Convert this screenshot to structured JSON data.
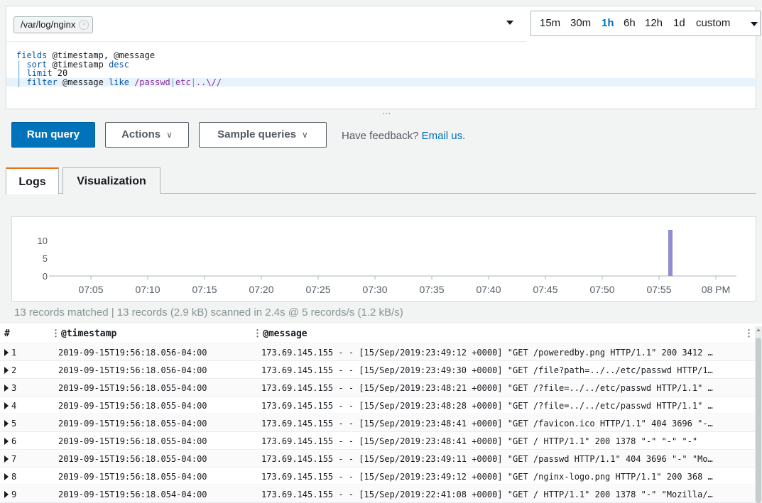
{
  "log_group": {
    "token": "/var/log/nginx",
    "remove_glyph": "×"
  },
  "time_range": {
    "options": [
      "15m",
      "30m",
      "1h",
      "6h",
      "12h",
      "1d",
      "custom"
    ],
    "active": "1h"
  },
  "query": {
    "line1": {
      "kw": "fields",
      "rest": " @timestamp, @message"
    },
    "line2": {
      "pipe": "| ",
      "kw": "sort",
      "rest": " @timestamp ",
      "kw2": "desc"
    },
    "line3": {
      "pipe": "| ",
      "kw": "limit",
      "rest": " 20"
    },
    "line4": {
      "pipe": "| ",
      "kw": "filter",
      "rest": " @message ",
      "kw2": "like",
      "regex_a": " /passwd",
      "bar1": "|",
      "regex_b": "etc",
      "bar2": "|",
      "regex_c": "..\\//"
    }
  },
  "ellipsis": "...",
  "buttons": {
    "run": "Run query",
    "actions": "Actions",
    "samples": "Sample queries",
    "chevron": "∨"
  },
  "feedback": {
    "text": "Have feedback?",
    "link": "Email us."
  },
  "tabs": {
    "logs": "Logs",
    "visualization": "Visualization"
  },
  "chart_data": {
    "type": "bar",
    "x": [
      "07:05",
      "07:10",
      "07:15",
      "07:20",
      "07:25",
      "07:30",
      "07:35",
      "07:40",
      "07:45",
      "07:50",
      "07:55",
      "08 PM"
    ],
    "y_ticks": [
      "10",
      "5",
      "0"
    ],
    "ylim": [
      0,
      13
    ],
    "series": [
      {
        "x": "19:56",
        "value": 13
      }
    ],
    "bar_color": "#8f8dd1"
  },
  "summary": "13 records matched | 13 records (2.9 kB) scanned in 2.4s @ 5 records/s (1.2 kB/s)",
  "table": {
    "headers": {
      "index": "#",
      "timestamp": "@timestamp",
      "message": "@message",
      "col_glyph": "⋮"
    },
    "rows": [
      {
        "n": "1",
        "ts": "2019-09-15T19:56:18.056-04:00",
        "msg": "173.69.145.155 - - [15/Sep/2019:23:49:12 +0000] \"GET /poweredby.png HTTP/1.1\" 200 3412 …"
      },
      {
        "n": "2",
        "ts": "2019-09-15T19:56:18.056-04:00",
        "msg": "173.69.145.155 - - [15/Sep/2019:23:49:30 +0000] \"GET /file?path=../../etc/passwd HTTP/1…"
      },
      {
        "n": "3",
        "ts": "2019-09-15T19:56:18.055-04:00",
        "msg": "173.69.145.155 - - [15/Sep/2019:23:48:21 +0000] \"GET /?file=../../etc/passwd HTTP/1.1\" …"
      },
      {
        "n": "4",
        "ts": "2019-09-15T19:56:18.055-04:00",
        "msg": "173.69.145.155 - - [15/Sep/2019:23:48:28 +0000] \"GET /?file=../../etc/passwd HTTP/1.1\" …"
      },
      {
        "n": "5",
        "ts": "2019-09-15T19:56:18.055-04:00",
        "msg": "173.69.145.155 - - [15/Sep/2019:23:48:41 +0000] \"GET /favicon.ico HTTP/1.1\" 404 3696 \"-…"
      },
      {
        "n": "6",
        "ts": "2019-09-15T19:56:18.055-04:00",
        "msg": "173.69.145.155 - - [15/Sep/2019:23:48:41 +0000] \"GET / HTTP/1.1\" 200 1378 \"-\" \"-\" \"-\""
      },
      {
        "n": "7",
        "ts": "2019-09-15T19:56:18.055-04:00",
        "msg": "173.69.145.155 - - [15/Sep/2019:23:49:11 +0000] \"GET /passwd HTTP/1.1\" 404 3696 \"-\" \"Mo…"
      },
      {
        "n": "8",
        "ts": "2019-09-15T19:56:18.055-04:00",
        "msg": "173.69.145.155 - - [15/Sep/2019:23:49:12 +0000] \"GET /nginx-logo.png HTTP/1.1\" 200 368 …"
      },
      {
        "n": "9",
        "ts": "2019-09-15T19:56:18.054-04:00",
        "msg": "173.69.145.155 - - [15/Sep/2019:22:41:08 +0000] \"GET / HTTP/1.1\" 200 1378 \"-\" \"Mozilla/…"
      }
    ]
  }
}
